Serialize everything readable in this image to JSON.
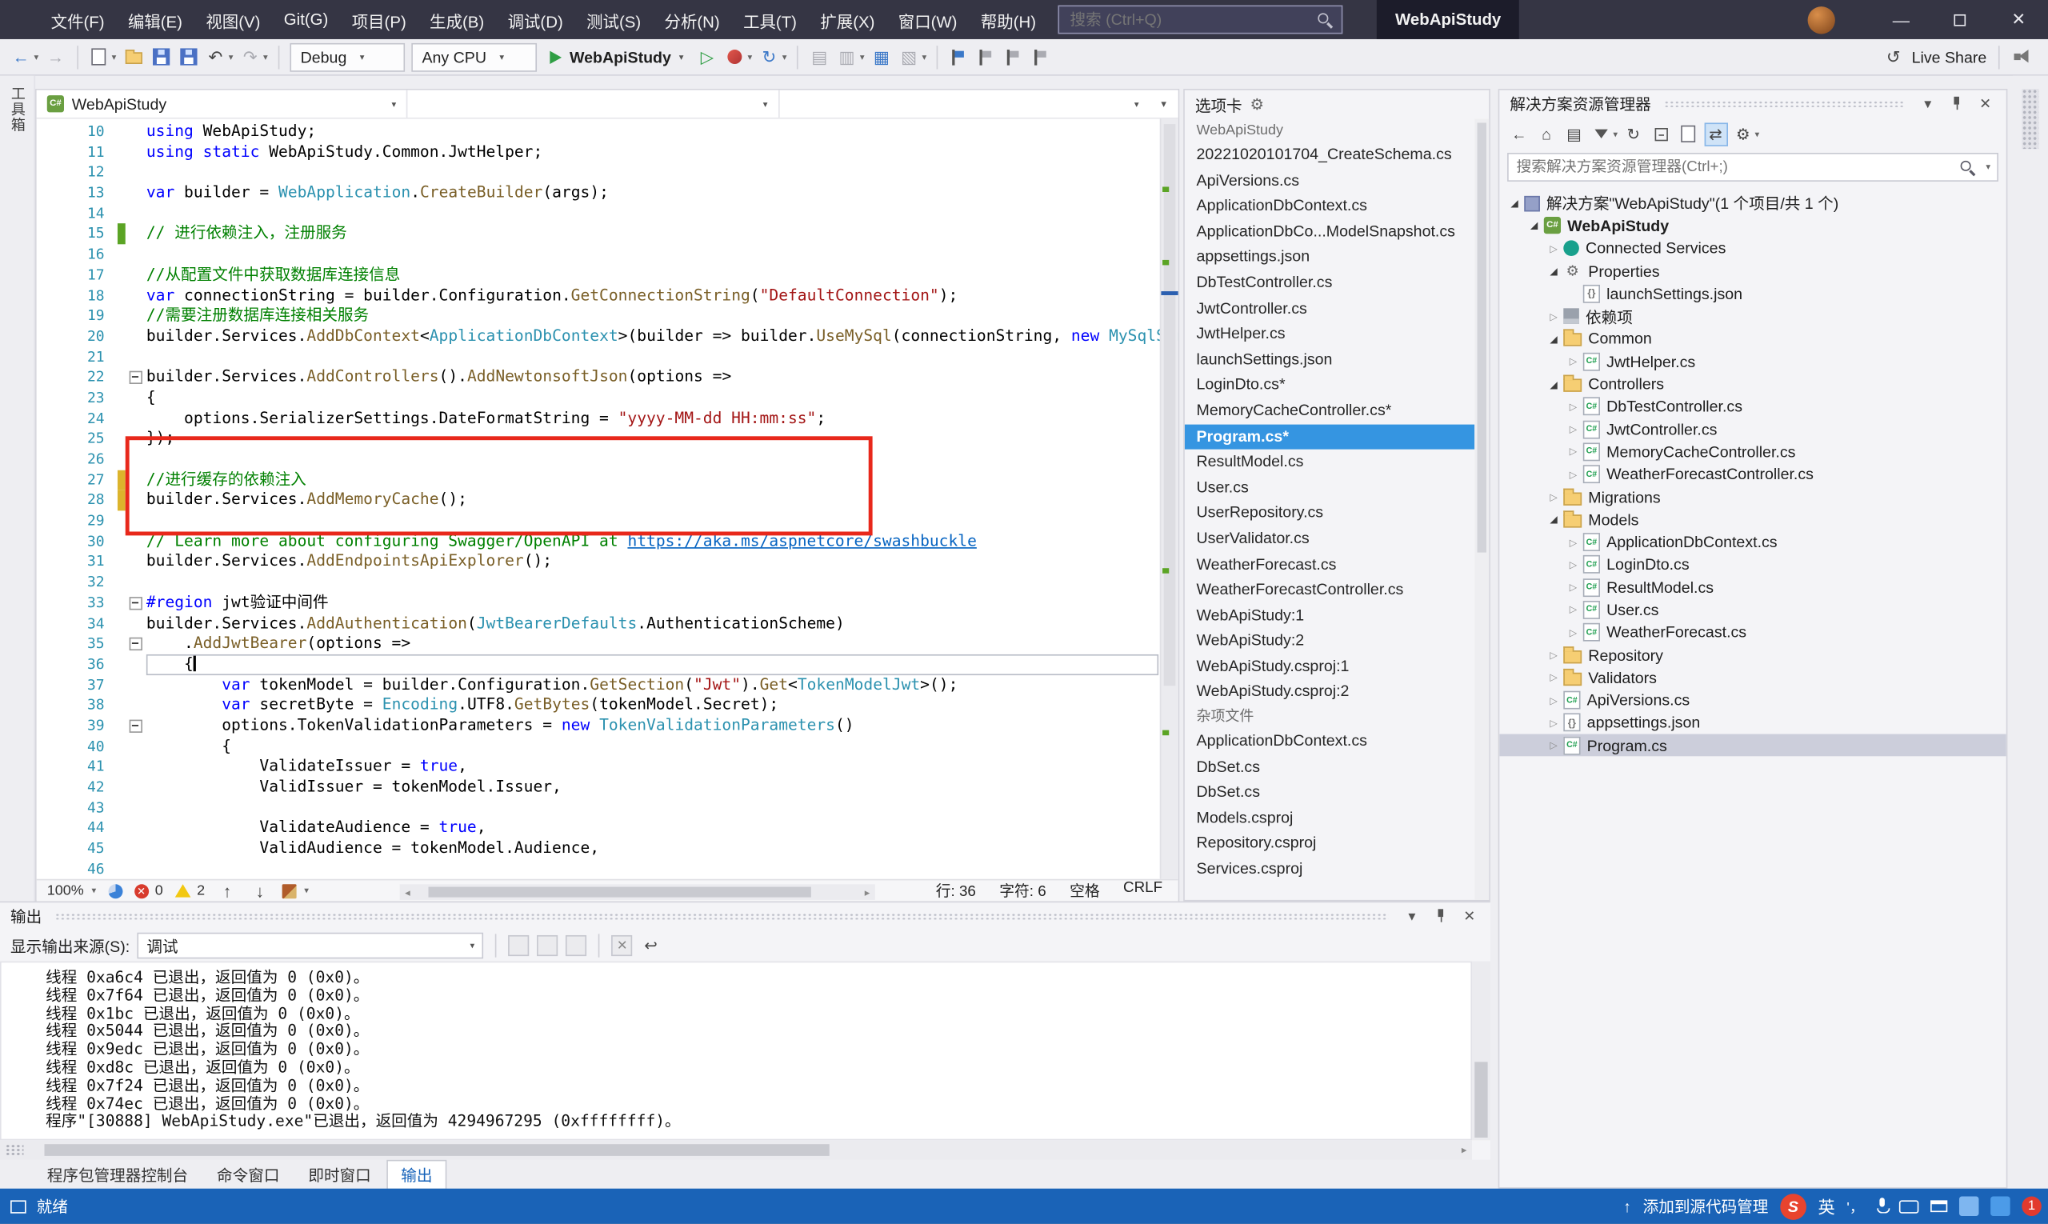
{
  "colors": {
    "titlebar_bg": "#353544",
    "toolbar_bg": "#eeeef2",
    "statusbar_bg": "#1A63B7",
    "selection_blue": "#3595E1",
    "inactive_selection": "#CCCEDB",
    "highlight_red": "#E8281B",
    "keyword_blue": "#0000ff",
    "comment_green": "#008000",
    "string_red": "#a31515",
    "type_teal": "#2b91af",
    "method_brown": "#795E26",
    "line_number": "#2b91af",
    "change_green": "#5BA425",
    "change_yellow": "#DCB42C"
  },
  "titlebar": {
    "menus": [
      "文件(F)",
      "编辑(E)",
      "视图(V)",
      "Git(G)",
      "项目(P)",
      "生成(B)",
      "调试(D)",
      "测试(S)",
      "分析(N)",
      "工具(T)",
      "扩展(X)",
      "窗口(W)",
      "帮助(H)"
    ],
    "search_placeholder": "搜索 (Ctrl+Q)",
    "window_title": "WebApiStudy"
  },
  "toolbar": {
    "config_dropdown": "Debug",
    "platform_dropdown": "Any CPU",
    "run_label": "WebApiStudy",
    "live_share_label": "Live Share"
  },
  "left_strip": {
    "label": "工具箱"
  },
  "editor": {
    "nav_project": "WebApiStudy",
    "zoom": "100%",
    "error_count": "0",
    "warning_count": "2",
    "status": {
      "line_label": "行: 36",
      "col_label": "字符: 6",
      "space_label": "空格",
      "eol": "CRLF"
    },
    "lines": [
      {
        "n": 10,
        "segs": [
          [
            "k",
            "using"
          ],
          [
            "p",
            " WebApiStudy;"
          ]
        ]
      },
      {
        "n": 11,
        "segs": [
          [
            "k",
            "using static"
          ],
          [
            "p",
            " WebApiStudy.Common.JwtHelper;"
          ]
        ]
      },
      {
        "n": 12,
        "segs": []
      },
      {
        "n": 13,
        "segs": [
          [
            "k",
            "var"
          ],
          [
            "p",
            " builder = "
          ],
          [
            "t",
            "WebApplication"
          ],
          [
            "p",
            "."
          ],
          [
            "m",
            "CreateBuilder"
          ],
          [
            "p",
            "(args);"
          ]
        ]
      },
      {
        "n": 14,
        "segs": []
      },
      {
        "n": 15,
        "mark": "g",
        "segs": [
          [
            "c",
            "// 进行依赖注入，注册服务"
          ]
        ]
      },
      {
        "n": 16,
        "segs": []
      },
      {
        "n": 17,
        "segs": [
          [
            "c",
            "//从配置文件中获取数据库连接信息"
          ]
        ]
      },
      {
        "n": 18,
        "segs": [
          [
            "k",
            "var"
          ],
          [
            "p",
            " connectionString = builder.Configuration."
          ],
          [
            "m",
            "GetConnectionString"
          ],
          [
            "p",
            "("
          ],
          [
            "s",
            "\"DefaultConnection\""
          ],
          [
            "p",
            ");"
          ]
        ]
      },
      {
        "n": 19,
        "segs": [
          [
            "c",
            "//需要注册数据库连接相关服务"
          ]
        ]
      },
      {
        "n": 20,
        "segs": [
          [
            "p",
            "builder.Services."
          ],
          [
            "m",
            "AddDbContext"
          ],
          [
            "p",
            "<"
          ],
          [
            "t",
            "ApplicationDbContext"
          ],
          [
            "p",
            ">(builder => builder."
          ],
          [
            "m",
            "UseMySql"
          ],
          [
            "p",
            "(connectionString, "
          ],
          [
            "k",
            "new"
          ],
          [
            "p",
            " "
          ],
          [
            "t",
            "MySqlServerVersion"
          ],
          [
            "p",
            "(new"
          ]
        ]
      },
      {
        "n": 21,
        "segs": []
      },
      {
        "n": 22,
        "fold": true,
        "segs": [
          [
            "p",
            "builder.Services."
          ],
          [
            "m",
            "AddControllers"
          ],
          [
            "p",
            "()."
          ],
          [
            "m",
            "AddNewtonsoftJson"
          ],
          [
            "p",
            "(options =>"
          ]
        ]
      },
      {
        "n": 23,
        "segs": [
          [
            "p",
            "{"
          ]
        ]
      },
      {
        "n": 24,
        "segs": [
          [
            "p",
            "    options.SerializerSettings.DateFormatString = "
          ],
          [
            "s",
            "\"yyyy-MM-dd HH:mm:ss\""
          ],
          [
            "p",
            ";"
          ]
        ]
      },
      {
        "n": 25,
        "segs": [
          [
            "p",
            "});"
          ]
        ]
      },
      {
        "n": 26,
        "segs": []
      },
      {
        "n": 27,
        "mark": "y",
        "segs": [
          [
            "c",
            "//进行缓存的依赖注入"
          ]
        ]
      },
      {
        "n": 28,
        "mark": "y",
        "segs": [
          [
            "p",
            "builder.Services."
          ],
          [
            "m",
            "AddMemoryCache"
          ],
          [
            "p",
            "();"
          ]
        ]
      },
      {
        "n": 29,
        "segs": []
      },
      {
        "n": 30,
        "segs": [
          [
            "c",
            "// Learn more about configuring Swagger/OpenAPI at "
          ],
          [
            "u",
            "https://aka.ms/aspnetcore/swashbuckle"
          ]
        ]
      },
      {
        "n": 31,
        "segs": [
          [
            "p",
            "builder.Services."
          ],
          [
            "m",
            "AddEndpointsApiExplorer"
          ],
          [
            "p",
            "();"
          ]
        ]
      },
      {
        "n": 32,
        "segs": []
      },
      {
        "n": 33,
        "fold": true,
        "segs": [
          [
            "k",
            "#region"
          ],
          [
            "p",
            " jwt验证中间件"
          ]
        ]
      },
      {
        "n": 34,
        "segs": [
          [
            "p",
            "builder.Services."
          ],
          [
            "m",
            "AddAuthentication"
          ],
          [
            "p",
            "("
          ],
          [
            "t",
            "JwtBearerDefaults"
          ],
          [
            "p",
            ".AuthenticationScheme)"
          ]
        ]
      },
      {
        "n": 35,
        "fold": true,
        "segs": [
          [
            "p",
            "    ."
          ],
          [
            "m",
            "AddJwtBearer"
          ],
          [
            "p",
            "(options =>"
          ]
        ]
      },
      {
        "n": 36,
        "cur": true,
        "caret": true,
        "segs": [
          [
            "p",
            "    {"
          ]
        ]
      },
      {
        "n": 37,
        "segs": [
          [
            "p",
            "        "
          ],
          [
            "k",
            "var"
          ],
          [
            "p",
            " tokenModel = builder.Configuration."
          ],
          [
            "m",
            "GetSection"
          ],
          [
            "p",
            "("
          ],
          [
            "s",
            "\"Jwt\""
          ],
          [
            "p",
            ")."
          ],
          [
            "m",
            "Get"
          ],
          [
            "p",
            "<"
          ],
          [
            "t",
            "TokenModelJwt"
          ],
          [
            "p",
            ">();"
          ]
        ]
      },
      {
        "n": 38,
        "segs": [
          [
            "p",
            "        "
          ],
          [
            "k",
            "var"
          ],
          [
            "p",
            " secretByte = "
          ],
          [
            "t",
            "Encoding"
          ],
          [
            "p",
            ".UTF8."
          ],
          [
            "m",
            "GetBytes"
          ],
          [
            "p",
            "(tokenModel.Secret);"
          ]
        ]
      },
      {
        "n": 39,
        "fold": true,
        "segs": [
          [
            "p",
            "        options.TokenValidationParameters = "
          ],
          [
            "k",
            "new"
          ],
          [
            "p",
            " "
          ],
          [
            "t",
            "TokenValidationParameters"
          ],
          [
            "p",
            "()"
          ]
        ]
      },
      {
        "n": 40,
        "segs": [
          [
            "p",
            "        {"
          ]
        ]
      },
      {
        "n": 41,
        "segs": [
          [
            "p",
            "            ValidateIssuer = "
          ],
          [
            "k",
            "true"
          ],
          [
            "p",
            ","
          ]
        ]
      },
      {
        "n": 42,
        "segs": [
          [
            "p",
            "            ValidIssuer = tokenModel.Issuer,"
          ]
        ]
      },
      {
        "n": 43,
        "segs": []
      },
      {
        "n": 44,
        "segs": [
          [
            "p",
            "            ValidateAudience = "
          ],
          [
            "k",
            "true"
          ],
          [
            "p",
            ","
          ]
        ]
      },
      {
        "n": 45,
        "segs": [
          [
            "p",
            "            ValidAudience = tokenModel.Audience,"
          ]
        ]
      },
      {
        "n": 46,
        "segs": []
      }
    ]
  },
  "tabs_panel": {
    "title": "选项卡",
    "group1_header": "WebApiStudy",
    "items": [
      "20221020101704_CreateSchema.cs",
      "ApiVersions.cs",
      "ApplicationDbContext.cs",
      "ApplicationDbCo...ModelSnapshot.cs",
      "appsettings.json",
      "DbTestController.cs",
      "JwtController.cs",
      "JwtHelper.cs",
      "launchSettings.json",
      "LoginDto.cs*",
      "MemoryCacheController.cs*",
      "Program.cs*",
      "ResultModel.cs",
      "User.cs",
      "UserRepository.cs",
      "UserValidator.cs",
      "WeatherForecast.cs",
      "WeatherForecastController.cs",
      "WebApiStudy:1",
      "WebApiStudy:2",
      "WebApiStudy.csproj:1",
      "WebApiStudy.csproj:2"
    ],
    "selected_index": 11,
    "group2_header": "杂项文件",
    "misc_items": [
      "ApplicationDbContext.cs",
      "DbSet.cs",
      "DbSet.cs",
      "Models.csproj",
      "Repository.csproj",
      "Services.csproj"
    ]
  },
  "solution_explorer": {
    "title": "解决方案资源管理器",
    "search_placeholder": "搜索解决方案资源管理器(Ctrl+;)",
    "tree": [
      {
        "label": "解决方案\"WebApiStudy\"(1 个项目/共 1 个)",
        "level": 0,
        "arrow": "exp",
        "icon": "sln"
      },
      {
        "label": "WebApiStudy",
        "level": 1,
        "arrow": "exp",
        "icon": "csproj",
        "bold": true
      },
      {
        "label": "Connected Services",
        "level": 2,
        "arrow": "col",
        "icon": "svc"
      },
      {
        "label": "Properties",
        "level": 2,
        "arrow": "exp",
        "icon": "props"
      },
      {
        "label": "launchSettings.json",
        "level": 3,
        "arrow": "",
        "icon": "json"
      },
      {
        "label": "依赖项",
        "level": 2,
        "arrow": "col",
        "icon": "deps"
      },
      {
        "label": "Common",
        "level": 2,
        "arrow": "exp",
        "icon": "folder"
      },
      {
        "label": "JwtHelper.cs",
        "level": 3,
        "arrow": "col",
        "icon": "cs"
      },
      {
        "label": "Controllers",
        "level": 2,
        "arrow": "exp",
        "icon": "folder"
      },
      {
        "label": "DbTestController.cs",
        "level": 3,
        "arrow": "col",
        "icon": "cs"
      },
      {
        "label": "JwtController.cs",
        "level": 3,
        "arrow": "col",
        "icon": "cs"
      },
      {
        "label": "MemoryCacheController.cs",
        "level": 3,
        "arrow": "col",
        "icon": "cs"
      },
      {
        "label": "WeatherForecastController.cs",
        "level": 3,
        "arrow": "col",
        "icon": "cs"
      },
      {
        "label": "Migrations",
        "level": 2,
        "arrow": "col",
        "icon": "folder"
      },
      {
        "label": "Models",
        "level": 2,
        "arrow": "exp",
        "icon": "folder"
      },
      {
        "label": "ApplicationDbContext.cs",
        "level": 3,
        "arrow": "col",
        "icon": "cs"
      },
      {
        "label": "LoginDto.cs",
        "level": 3,
        "arrow": "col",
        "icon": "cs"
      },
      {
        "label": "ResultModel.cs",
        "level": 3,
        "arrow": "col",
        "icon": "cs"
      },
      {
        "label": "User.cs",
        "level": 3,
        "arrow": "col",
        "icon": "cs"
      },
      {
        "label": "WeatherForecast.cs",
        "level": 3,
        "arrow": "col",
        "icon": "cs"
      },
      {
        "label": "Repository",
        "level": 2,
        "arrow": "col",
        "icon": "folder"
      },
      {
        "label": "Validators",
        "level": 2,
        "arrow": "col",
        "icon": "folder"
      },
      {
        "label": "ApiVersions.cs",
        "level": 2,
        "arrow": "col",
        "icon": "cs"
      },
      {
        "label": "appsettings.json",
        "level": 2,
        "arrow": "col",
        "icon": "json"
      },
      {
        "label": "Program.cs",
        "level": 2,
        "arrow": "col",
        "icon": "cs",
        "selected": true
      }
    ]
  },
  "output": {
    "title": "输出",
    "source_label": "显示输出来源(S):",
    "source_value": "调试",
    "lines": [
      "线程 0xa6c4 已退出，返回值为 0 (0x0)。",
      "线程 0x7f64 已退出，返回值为 0 (0x0)。",
      "线程 0x1bc 已退出，返回值为 0 (0x0)。",
      "线程 0x5044 已退出，返回值为 0 (0x0)。",
      "线程 0x9edc 已退出，返回值为 0 (0x0)。",
      "线程 0xd8c 已退出，返回值为 0 (0x0)。",
      "线程 0x7f24 已退出，返回值为 0 (0x0)。",
      "线程 0x74ec 已退出，返回值为 0 (0x0)。",
      "程序\"[30888] WebApiStudy.exe\"已退出，返回值为 4294967295 (0xffffffff)。"
    ]
  },
  "bottom_tabs": {
    "tabs": [
      "程序包管理器控制台",
      "命令窗口",
      "即时窗口",
      "输出"
    ],
    "active_index": 3
  },
  "statusbar": {
    "ready": "就绪",
    "source_control": "添加到源代码管理",
    "ime_lang": "英",
    "ime_punct": "'，",
    "badge": "1"
  }
}
